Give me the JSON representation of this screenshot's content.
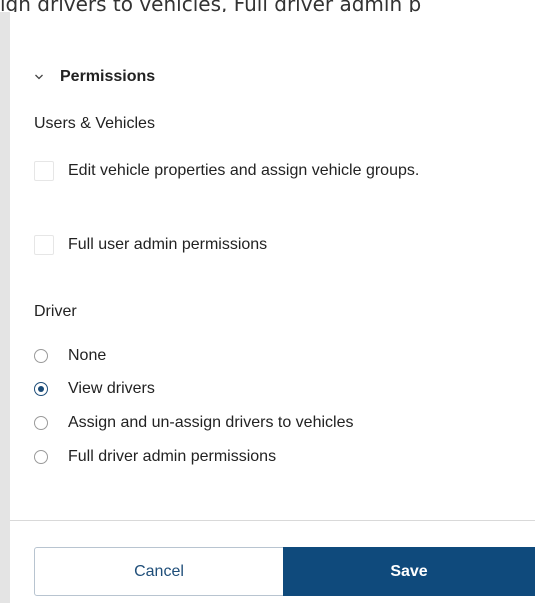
{
  "top_banner_text": "ign drivers to vehicles, Full driver admin p",
  "permissions": {
    "title": "Permissions",
    "users_vehicles": {
      "label": "Users & Vehicles",
      "options": [
        {
          "label": "Edit vehicle properties and assign vehicle groups.",
          "checked": false
        },
        {
          "label": "Full user admin permissions",
          "checked": false
        }
      ]
    },
    "driver": {
      "label": "Driver",
      "options": [
        {
          "label": "None",
          "selected": false
        },
        {
          "label": "View drivers",
          "selected": true
        },
        {
          "label": "Assign and un-assign drivers to vehicles",
          "selected": false
        },
        {
          "label": "Full driver admin permissions",
          "selected": false
        }
      ]
    }
  },
  "footer": {
    "cancel_label": "Cancel",
    "save_label": "Save"
  },
  "colors": {
    "primary": "#0f4a7c",
    "radio_selected": "#1a4b78"
  },
  "icons": {
    "section_toggle": "chevron-down-icon"
  }
}
